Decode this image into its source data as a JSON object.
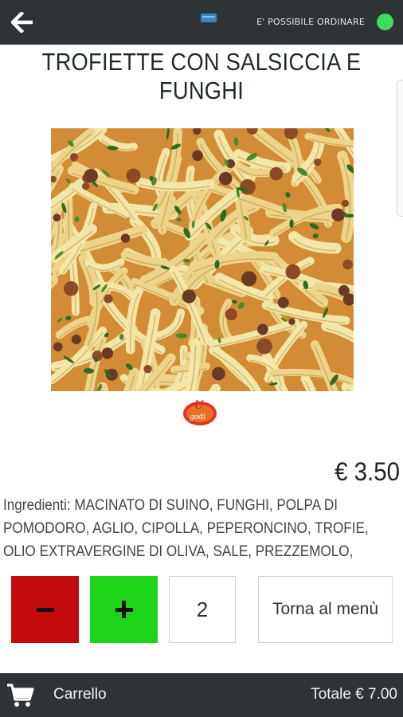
{
  "topbar": {
    "back_icon": "arrow-left-icon",
    "center_icon": "battery-indicator-icon",
    "order_status": "E' POSSIBILE ORDINARE",
    "status_color": "#3ddc5c"
  },
  "product": {
    "title": "TROFIETTE CON SALSICCIA E FUNGHI",
    "price": "€ 3.50",
    "ingredients": "Ingredienti: MACINATO DI SUINO, FUNGHI, POLPA DI POMODORO, AGLIO, CIPOLLA, PEPERONCINO, TROFIE, OLIO EXTRAVERGINE DI OLIVA, SALE, PREZZEMOLO, ALLORO,",
    "image_icon": "dish-photo",
    "brand_logo_text": "U godi"
  },
  "controls": {
    "minus_symbol": "minus-icon",
    "plus_symbol": "plus-icon",
    "quantity": "2",
    "back_to_menu": "Torna al menù",
    "minus_color": "#c30b0b",
    "plus_color": "#1ed418"
  },
  "bottombar": {
    "cart_icon": "cart-icon",
    "cart_label": "Carrello",
    "total": "Totale € 7.00"
  }
}
